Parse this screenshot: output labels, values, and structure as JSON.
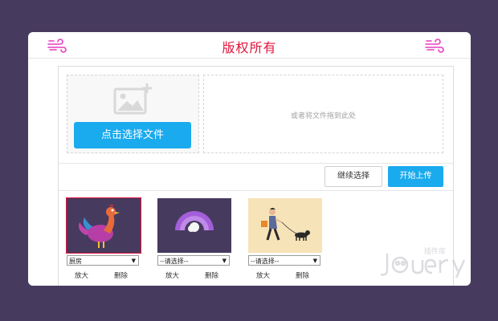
{
  "header": {
    "title": "版权所有"
  },
  "uploader": {
    "select_button_label": "点击选择文件",
    "drag_hint": "或者将文件拖到此处",
    "continue_button_label": "继续选择",
    "start_button_label": "开始上传"
  },
  "files": [
    {
      "category": "厨房",
      "zoom_label": "放大",
      "delete_label": "删除",
      "selected": true,
      "picture": "rooster"
    },
    {
      "category": "--请选择--",
      "zoom_label": "放大",
      "delete_label": "删除",
      "selected": false,
      "picture": "rainbow"
    },
    {
      "category": "--请选择--",
      "zoom_label": "放大",
      "delete_label": "删除",
      "selected": false,
      "picture": "woman-walking-dog"
    }
  ],
  "watermark": {
    "brand": "jQuery",
    "tag": "插件库"
  },
  "colors": {
    "page_bg": "#473a5f",
    "accent_blue": "#1aaaee",
    "title_red": "#e0143c",
    "icon_magenta": "#e83cc1"
  }
}
